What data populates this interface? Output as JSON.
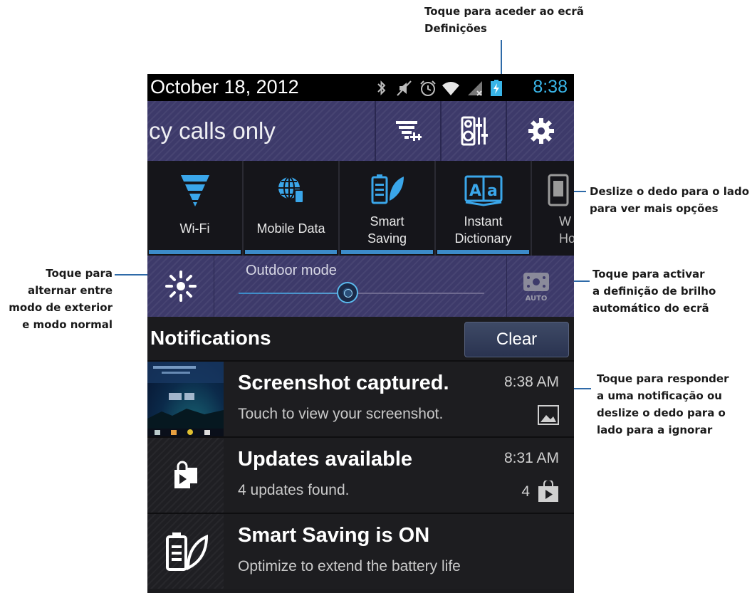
{
  "status_bar": {
    "date": "October 18, 2012",
    "time": "8:38",
    "icons": [
      "bluetooth-icon",
      "mute-icon",
      "alarm-icon",
      "wifi-icon",
      "no-sim-icon",
      "battery-charging-icon"
    ]
  },
  "top_row": {
    "carrier_text": "cy calls only",
    "buttons": [
      "quick-settings-icon",
      "audio-wizard-icon",
      "settings-gear-icon"
    ]
  },
  "quick_tiles": [
    {
      "label": "Wi-Fi",
      "icon": "wifi-funnel-icon"
    },
    {
      "label": "Mobile Data",
      "icon": "mobile-data-icon"
    },
    {
      "label": "Smart\nSaving",
      "icon": "smart-saving-icon"
    },
    {
      "label": "Instant\nDictionary",
      "icon": "dictionary-icon"
    },
    {
      "label": "W\nHot",
      "icon": "hotspot-icon"
    }
  ],
  "brightness": {
    "outdoor_label": "Outdoor mode",
    "auto_label": "AUTO",
    "level": 0.45
  },
  "notifications": {
    "header": "Notifications",
    "clear_label": "Clear",
    "items": [
      {
        "title": "Screenshot captured.",
        "subtitle": "Touch to view your screenshot.",
        "time": "8:38 AM"
      },
      {
        "title": "Updates available",
        "subtitle": "4 updates found.",
        "time": "8:31 AM",
        "count": "4"
      },
      {
        "title": "Smart Saving is ON",
        "subtitle": "Optimize to extend the battery life"
      }
    ]
  },
  "callouts": {
    "settings": [
      "Toque para aceder ao ecrã",
      "Definições"
    ],
    "swipe": [
      "Deslize o dedo para o lado",
      "para ver mais opções"
    ],
    "outdoor": [
      "Toque para",
      "alternar entre",
      "modo de exterior",
      "e modo normal"
    ],
    "auto": [
      "Toque para activar",
      "a definição de brilho",
      "automático do ecrã"
    ],
    "notification": [
      "Toque para responder",
      "a uma notificação ou",
      "deslize o dedo para o",
      "lado para a ignorar"
    ]
  },
  "colors": {
    "accent_blue": "#39b5e8",
    "panel_purple": "#3d3a6a",
    "callout_line": "#2e6aa8"
  }
}
